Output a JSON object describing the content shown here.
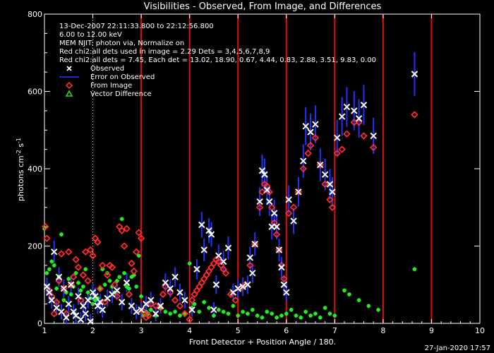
{
  "chart_data": {
    "type": "scatter",
    "title": "Visibilities - Observed, From Image, and Differences",
    "xlabel": "Front Detector + Position Angle / 180.",
    "ylabel": "photons cm",
    "ylabel_exp1": "-2",
    "ylabel_mid": " s",
    "ylabel_exp2": "-1",
    "xlim": [
      1,
      10
    ],
    "ylim": [
      0,
      800
    ],
    "xticks": [
      1,
      2,
      3,
      4,
      5,
      6,
      7,
      8,
      9,
      10
    ],
    "yticks": [
      0,
      200,
      400,
      600,
      800
    ],
    "timestamp": "27-Jan-2020 17:57",
    "info_lines": [
      "13-Dec-2007 22:11:33.800 to 22:12:56.800",
      "6.00 to 12.00 keV",
      "MEM NJIT: photon via,   Normalize on",
      "Red chi2:all dets used in image = 2.29   Dets = 3,4,5,6,7,8,9",
      "Red chi2:all dets = 7.45,  Each det = 13.02, 18.90, 0.67, 4.44, 0.83, 2.88, 3.51, 9.83, 0.00"
    ],
    "legend": {
      "placement": "top-left",
      "entries": [
        {
          "label": "Observed",
          "symbol": "x",
          "color": "#ffffff"
        },
        {
          "label": "Error on Observed",
          "symbol": "line",
          "color": "#2233ff"
        },
        {
          "label": "From Image",
          "symbol": "diamond",
          "color": "#ff2a2a"
        },
        {
          "label": "Vector Difference",
          "symbol": "triangle",
          "color": "#22dd22"
        }
      ]
    },
    "detector_boundaries": [
      3,
      4,
      5,
      6,
      7,
      8,
      9
    ],
    "dotted_line_x": 2,
    "colors": {
      "observed": "#ffffff",
      "error": "#2233ff",
      "image": "#ff2a2a",
      "difference": "#22ee22",
      "boundary": "#e01010"
    },
    "series": [
      {
        "name": "Observed",
        "points": [
          [
            1.05,
            95
          ],
          [
            1.1,
            80
          ],
          [
            1.15,
            60
          ],
          [
            1.2,
            185
          ],
          [
            1.25,
            40
          ],
          [
            1.3,
            120
          ],
          [
            1.35,
            30
          ],
          [
            1.4,
            90
          ],
          [
            1.45,
            15
          ],
          [
            1.5,
            50
          ],
          [
            1.55,
            100
          ],
          [
            1.6,
            30
          ],
          [
            1.65,
            20
          ],
          [
            1.7,
            70
          ],
          [
            1.75,
            10
          ],
          [
            1.8,
            45
          ],
          [
            1.85,
            25
          ],
          [
            1.9,
            60
          ],
          [
            1.95,
            5
          ],
          [
            2.0,
            80
          ],
          [
            2.05,
            70
          ],
          [
            2.1,
            45
          ],
          [
            2.15,
            55
          ],
          [
            2.2,
            35
          ],
          [
            2.3,
            65
          ],
          [
            2.4,
            75
          ],
          [
            2.5,
            85
          ],
          [
            2.6,
            55
          ],
          [
            2.7,
            105
          ],
          [
            2.8,
            45
          ],
          [
            2.9,
            30
          ],
          [
            3.0,
            35
          ],
          [
            3.1,
            50
          ],
          [
            3.2,
            60
          ],
          [
            3.3,
            25
          ],
          [
            3.4,
            45
          ],
          [
            3.5,
            105
          ],
          [
            3.6,
            90
          ],
          [
            3.7,
            120
          ],
          [
            3.8,
            80
          ],
          [
            3.9,
            60
          ],
          [
            4.05,
            35
          ],
          [
            4.15,
            140
          ],
          [
            4.25,
            255
          ],
          [
            4.3,
            190
          ],
          [
            4.4,
            240
          ],
          [
            4.45,
            230
          ],
          [
            4.5,
            35
          ],
          [
            4.55,
            100
          ],
          [
            4.6,
            175
          ],
          [
            4.7,
            160
          ],
          [
            4.8,
            195
          ],
          [
            4.9,
            80
          ],
          [
            5.0,
            90
          ],
          [
            5.1,
            95
          ],
          [
            5.2,
            100
          ],
          [
            5.25,
            170
          ],
          [
            5.3,
            130
          ],
          [
            5.35,
            205
          ],
          [
            5.45,
            315
          ],
          [
            5.5,
            395
          ],
          [
            5.55,
            385
          ],
          [
            5.6,
            345
          ],
          [
            5.65,
            315
          ],
          [
            5.7,
            250
          ],
          [
            5.75,
            285
          ],
          [
            5.8,
            250
          ],
          [
            5.85,
            190
          ],
          [
            5.9,
            145
          ],
          [
            5.95,
            100
          ],
          [
            6.0,
            80
          ],
          [
            6.05,
            320
          ],
          [
            6.15,
            265
          ],
          [
            6.25,
            340
          ],
          [
            6.35,
            420
          ],
          [
            6.4,
            510
          ],
          [
            6.5,
            495
          ],
          [
            6.6,
            515
          ],
          [
            6.7,
            410
          ],
          [
            6.8,
            385
          ],
          [
            6.9,
            360
          ],
          [
            6.95,
            340
          ],
          [
            7.05,
            480
          ],
          [
            7.15,
            535
          ],
          [
            7.25,
            560
          ],
          [
            7.4,
            550
          ],
          [
            7.5,
            530
          ],
          [
            7.6,
            565
          ],
          [
            7.8,
            485
          ],
          [
            8.65,
            645
          ]
        ]
      },
      {
        "name": "From Image",
        "points": [
          [
            1.02,
            250
          ],
          [
            1.05,
            220
          ],
          [
            1.1,
            85
          ],
          [
            1.15,
            70
          ],
          [
            1.2,
            25
          ],
          [
            1.25,
            55
          ],
          [
            1.3,
            110
          ],
          [
            1.35,
            180
          ],
          [
            1.4,
            90
          ],
          [
            1.45,
            25
          ],
          [
            1.5,
            185
          ],
          [
            1.55,
            100
          ],
          [
            1.6,
            120
          ],
          [
            1.65,
            165
          ],
          [
            1.7,
            145
          ],
          [
            1.75,
            60
          ],
          [
            1.8,
            125
          ],
          [
            1.85,
            185
          ],
          [
            1.9,
            110
          ],
          [
            1.95,
            190
          ],
          [
            2.0,
            175
          ],
          [
            2.05,
            220
          ],
          [
            2.1,
            210
          ],
          [
            2.15,
            90
          ],
          [
            2.2,
            150
          ],
          [
            2.25,
            55
          ],
          [
            2.3,
            125
          ],
          [
            2.35,
            150
          ],
          [
            2.4,
            145
          ],
          [
            2.45,
            100
          ],
          [
            2.5,
            70
          ],
          [
            2.55,
            250
          ],
          [
            2.6,
            240
          ],
          [
            2.65,
            200
          ],
          [
            2.7,
            245
          ],
          [
            2.75,
            75
          ],
          [
            2.8,
            155
          ],
          [
            2.85,
            135
          ],
          [
            2.9,
            185
          ],
          [
            2.95,
            235
          ],
          [
            3.0,
            220
          ],
          [
            3.05,
            30
          ],
          [
            3.1,
            15
          ],
          [
            3.15,
            20
          ],
          [
            3.2,
            50
          ],
          [
            3.3,
            45
          ],
          [
            3.4,
            40
          ],
          [
            3.45,
            75
          ],
          [
            3.5,
            95
          ],
          [
            3.6,
            80
          ],
          [
            3.7,
            60
          ],
          [
            3.8,
            45
          ],
          [
            3.9,
            25
          ],
          [
            4.0,
            10
          ],
          [
            4.05,
            60
          ],
          [
            4.1,
            75
          ],
          [
            4.15,
            85
          ],
          [
            4.2,
            95
          ],
          [
            4.25,
            105
          ],
          [
            4.3,
            115
          ],
          [
            4.35,
            125
          ],
          [
            4.4,
            135
          ],
          [
            4.45,
            145
          ],
          [
            4.5,
            155
          ],
          [
            4.55,
            165
          ],
          [
            4.6,
            160
          ],
          [
            4.65,
            150
          ],
          [
            4.7,
            140
          ],
          [
            4.75,
            130
          ],
          [
            4.85,
            75
          ],
          [
            4.95,
            60
          ],
          [
            5.05,
            90
          ],
          [
            5.15,
            100
          ],
          [
            5.25,
            150
          ],
          [
            5.35,
            205
          ],
          [
            5.45,
            300
          ],
          [
            5.5,
            340
          ],
          [
            5.55,
            360
          ],
          [
            5.6,
            355
          ],
          [
            5.65,
            340
          ],
          [
            5.7,
            300
          ],
          [
            5.75,
            260
          ],
          [
            5.8,
            230
          ],
          [
            5.85,
            190
          ],
          [
            5.9,
            150
          ],
          [
            5.95,
            115
          ],
          [
            6.05,
            285
          ],
          [
            6.15,
            300
          ],
          [
            6.25,
            340
          ],
          [
            6.35,
            400
          ],
          [
            6.45,
            440
          ],
          [
            6.5,
            460
          ],
          [
            6.6,
            480
          ],
          [
            6.7,
            410
          ],
          [
            6.8,
            360
          ],
          [
            6.9,
            320
          ],
          [
            6.95,
            300
          ],
          [
            7.05,
            440
          ],
          [
            7.15,
            450
          ],
          [
            7.25,
            490
          ],
          [
            7.4,
            520
          ],
          [
            7.5,
            520
          ],
          [
            7.6,
            485
          ],
          [
            7.8,
            455
          ],
          [
            8.65,
            540
          ]
        ]
      },
      {
        "name": "Vector Difference",
        "points": [
          [
            1.0,
            245
          ],
          [
            1.05,
            130
          ],
          [
            1.1,
            140
          ],
          [
            1.15,
            160
          ],
          [
            1.2,
            150
          ],
          [
            1.25,
            90
          ],
          [
            1.3,
            120
          ],
          [
            1.35,
            230
          ],
          [
            1.4,
            60
          ],
          [
            1.45,
            80
          ],
          [
            1.5,
            115
          ],
          [
            1.55,
            75
          ],
          [
            1.6,
            95
          ],
          [
            1.65,
            130
          ],
          [
            1.7,
            105
          ],
          [
            1.75,
            85
          ],
          [
            1.8,
            95
          ],
          [
            1.85,
            140
          ],
          [
            1.9,
            80
          ],
          [
            1.95,
            65
          ],
          [
            2.0,
            50
          ],
          [
            2.05,
            60
          ],
          [
            2.1,
            65
          ],
          [
            2.15,
            90
          ],
          [
            2.2,
            140
          ],
          [
            2.25,
            100
          ],
          [
            2.3,
            130
          ],
          [
            2.35,
            110
          ],
          [
            2.4,
            95
          ],
          [
            2.45,
            80
          ],
          [
            2.5,
            110
          ],
          [
            2.55,
            120
          ],
          [
            2.6,
            270
          ],
          [
            2.65,
            130
          ],
          [
            2.7,
            95
          ],
          [
            2.75,
            90
          ],
          [
            2.8,
            120
          ],
          [
            2.85,
            125
          ],
          [
            2.9,
            95
          ],
          [
            2.95,
            175
          ],
          [
            3.0,
            70
          ],
          [
            3.05,
            20
          ],
          [
            3.1,
            30
          ],
          [
            3.15,
            25
          ],
          [
            3.2,
            35
          ],
          [
            3.3,
            20
          ],
          [
            3.4,
            40
          ],
          [
            3.5,
            30
          ],
          [
            3.6,
            25
          ],
          [
            3.7,
            30
          ],
          [
            3.8,
            20
          ],
          [
            3.9,
            25
          ],
          [
            4.0,
            155
          ],
          [
            4.05,
            40
          ],
          [
            4.1,
            50
          ],
          [
            4.2,
            30
          ],
          [
            4.3,
            55
          ],
          [
            4.4,
            40
          ],
          [
            4.5,
            20
          ],
          [
            4.6,
            35
          ],
          [
            4.7,
            30
          ],
          [
            4.8,
            25
          ],
          [
            4.9,
            45
          ],
          [
            5.0,
            20
          ],
          [
            5.1,
            30
          ],
          [
            5.2,
            25
          ],
          [
            5.3,
            35
          ],
          [
            5.4,
            20
          ],
          [
            5.5,
            15
          ],
          [
            5.6,
            30
          ],
          [
            5.7,
            25
          ],
          [
            5.8,
            15
          ],
          [
            5.9,
            20
          ],
          [
            6.0,
            25
          ],
          [
            6.1,
            35
          ],
          [
            6.2,
            20
          ],
          [
            6.3,
            15
          ],
          [
            6.4,
            30
          ],
          [
            6.5,
            20
          ],
          [
            6.6,
            25
          ],
          [
            6.7,
            15
          ],
          [
            6.8,
            40
          ],
          [
            6.9,
            25
          ],
          [
            7.0,
            20
          ],
          [
            7.2,
            85
          ],
          [
            7.3,
            75
          ],
          [
            7.5,
            60
          ],
          [
            7.7,
            45
          ],
          [
            7.9,
            35
          ],
          [
            8.65,
            140
          ]
        ]
      }
    ]
  }
}
